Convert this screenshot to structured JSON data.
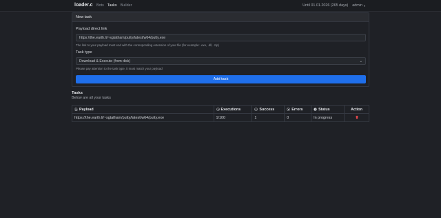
{
  "navbar": {
    "brand": "loader.c",
    "links": [
      "Bots",
      "Tasks",
      "Builder"
    ],
    "expiry": "Until 01.01.2026 (265 days)",
    "user": "admin"
  },
  "new_task": {
    "header": "New task",
    "payload_label": "Payload direct link",
    "payload_value": "https://the.earth.li/~sgtatham/putty/latest/w64/putty.exe",
    "payload_help": "The link to your payload must end with the corresponding extension of your file (for example: .exe, .dll, .zip)",
    "task_type_label": "Task type",
    "task_type_value": "Download & Execute (from disk)",
    "task_type_help": "Please pay attention to the task type, it must match your payload",
    "add_button": "Add task"
  },
  "tasks": {
    "title": "Tasks",
    "subtitle": "Below are all your tasks",
    "columns": [
      "Payload",
      "Executions",
      "Success",
      "Errors",
      "Status",
      "Action"
    ],
    "column_icons": [
      "file-icon",
      "play-circle-icon",
      "check-circle-icon",
      "x-circle-icon",
      "info-circle-icon"
    ],
    "rows": [
      {
        "payload": "https://the.earth.li/~sgtatham/putty/latest/w64/putty.exe",
        "executions": "1/100",
        "success": "1",
        "errors": "0",
        "status": "In progress",
        "action_icon": "trash-icon"
      }
    ]
  },
  "colors": {
    "background": "#1f2126",
    "accent": "#1f6feb",
    "danger": "#e5484d"
  }
}
